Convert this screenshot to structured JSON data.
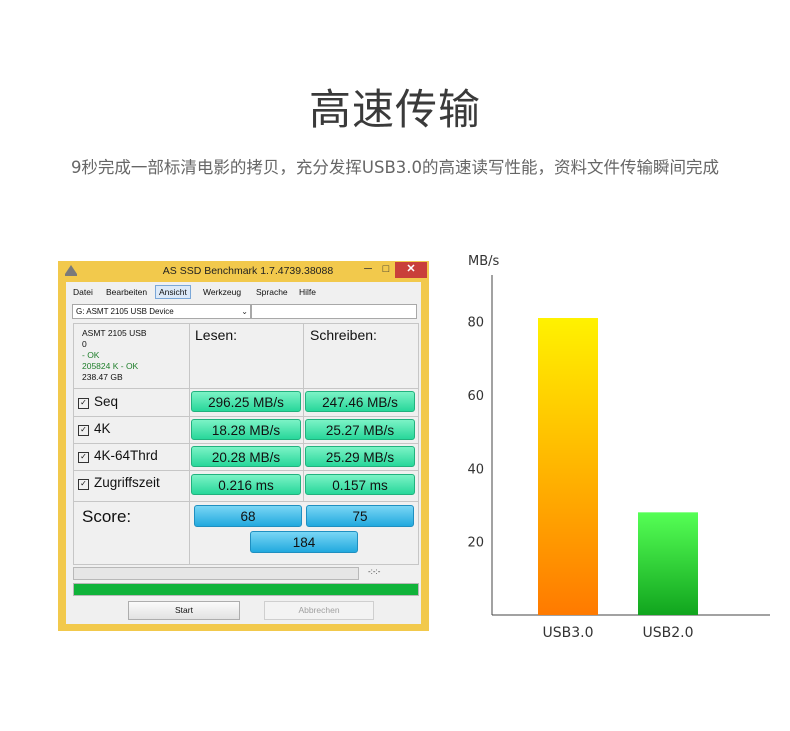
{
  "headline": "高速传输",
  "subline": "9秒完成一部标清电影的拷贝，充分发挥USB3.0的高速读写性能，资料文件传输瞬间完成",
  "window": {
    "title": "AS SSD Benchmark 1.7.4739.38088",
    "minimize": "─",
    "maximize": "□",
    "close": "✕",
    "menu": [
      "Datei",
      "Bearbeiten",
      "Ansicht",
      "Werkzeug",
      "Sprache",
      "Hilfe"
    ],
    "drive_select": "G: ASMT 2105 USB Device",
    "drive_info": {
      "name": "ASMT 2105 USB",
      "line2": "0",
      "line3": " - OK",
      "line4": "205824 K - OK",
      "line5": "238.47 GB"
    },
    "col_read": "Lesen:",
    "col_write": "Schreiben:",
    "rows": [
      {
        "label": "Seq",
        "read": "296.25 MB/s",
        "write": "247.46 MB/s"
      },
      {
        "label": "4K",
        "read": "18.28 MB/s",
        "write": "25.27 MB/s"
      },
      {
        "label": "4K-64Thrd",
        "read": "20.28 MB/s",
        "write": "25.29 MB/s"
      },
      {
        "label": "Zugriffszeit",
        "read": "0.216 ms",
        "write": "0.157 ms"
      }
    ],
    "checkbox_mark": "✓",
    "score_label": "Score:",
    "score_read": "68",
    "score_write": "75",
    "score_total": "184",
    "timer": "-:-:-",
    "progress_top": 0,
    "progress_bottom": 1,
    "start_button": "Start",
    "abort_button": "Abbrechen",
    "accent_color": "#f2c94c",
    "value_color": "#28d79a",
    "score_color": "#22a9de"
  },
  "chart_data": {
    "type": "bar",
    "ylabel": "MB/s",
    "categories": [
      "USB3.0",
      "USB2.0"
    ],
    "values": [
      81,
      28
    ],
    "ylim": [
      0,
      90
    ],
    "yticks": [
      20,
      40,
      60,
      80
    ],
    "grid": false,
    "colors": [
      [
        "#fff200",
        "#ff7a00"
      ],
      [
        "#55ff55",
        "#11a51e"
      ]
    ]
  }
}
